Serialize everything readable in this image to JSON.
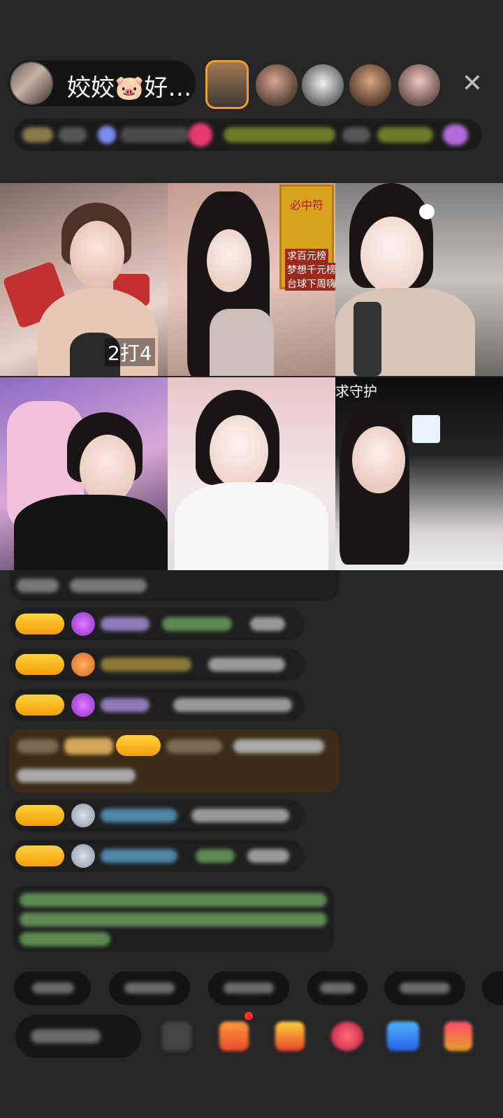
{
  "header": {
    "host_name": "姣姣🐷好…",
    "close_symbol": "✕"
  },
  "video_tiles": {
    "tile1_badge": "2打4",
    "tile2_banner_title": "必中符",
    "tile2_banner_lines": [
      "求百元榜",
      "梦想千元榜",
      "台球下周嗨"
    ],
    "tile6_label": "求守护"
  },
  "colors": {
    "background": "#262626",
    "badge_gold": "#f6b51c",
    "pill_bg": "#141414",
    "green_text": "#7cbd4a"
  }
}
